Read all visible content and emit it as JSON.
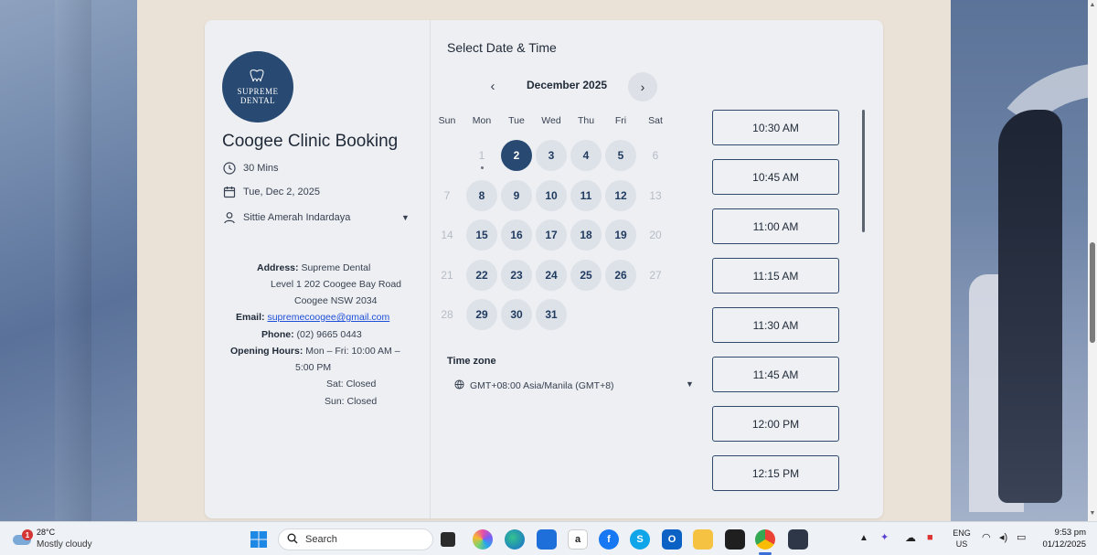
{
  "booking": {
    "logo_line1": "SUPREME",
    "logo_line2": "DENTAL",
    "title": "Coogee Clinic Booking",
    "duration": "30 Mins",
    "date": "Tue, Dec 2, 2025",
    "staff": "Sittie Amerah Indardaya"
  },
  "address": {
    "address_label": "Address:",
    "address_line1": "Supreme Dental",
    "address_line2": "Level 1  202 Coogee Bay Road",
    "address_line3": "Coogee NSW 2034",
    "email_label": "Email:",
    "email": "supremecoogee@gmail.com",
    "phone_label": "Phone:",
    "phone": "(02) 9665 0443",
    "hours_label": "Opening Hours:",
    "hours_line1": "Mon – Fri: 10:00 AM –",
    "hours_line2": "5:00 PM",
    "hours_sat": "Sat: Closed",
    "hours_sun": "Sun: Closed"
  },
  "calendar": {
    "section_title": "Select Date & Time",
    "month_label": "December 2025",
    "prev_icon": "‹",
    "next_icon": "›",
    "weekdays": [
      "Sun",
      "Mon",
      "Tue",
      "Wed",
      "Thu",
      "Fri",
      "Sat"
    ],
    "weeks": [
      [
        {
          "d": "",
          "s": "empty"
        },
        {
          "d": "1",
          "s": "off",
          "today": true
        },
        {
          "d": "2",
          "s": "sel"
        },
        {
          "d": "3",
          "s": "avail"
        },
        {
          "d": "4",
          "s": "avail"
        },
        {
          "d": "5",
          "s": "avail"
        },
        {
          "d": "6",
          "s": "off"
        }
      ],
      [
        {
          "d": "7",
          "s": "off"
        },
        {
          "d": "8",
          "s": "avail"
        },
        {
          "d": "9",
          "s": "avail"
        },
        {
          "d": "10",
          "s": "avail"
        },
        {
          "d": "11",
          "s": "avail"
        },
        {
          "d": "12",
          "s": "avail"
        },
        {
          "d": "13",
          "s": "off"
        }
      ],
      [
        {
          "d": "14",
          "s": "off"
        },
        {
          "d": "15",
          "s": "avail"
        },
        {
          "d": "16",
          "s": "avail"
        },
        {
          "d": "17",
          "s": "avail"
        },
        {
          "d": "18",
          "s": "avail"
        },
        {
          "d": "19",
          "s": "avail"
        },
        {
          "d": "20",
          "s": "off"
        }
      ],
      [
        {
          "d": "21",
          "s": "off"
        },
        {
          "d": "22",
          "s": "avail"
        },
        {
          "d": "23",
          "s": "avail"
        },
        {
          "d": "24",
          "s": "avail"
        },
        {
          "d": "25",
          "s": "avail"
        },
        {
          "d": "26",
          "s": "avail"
        },
        {
          "d": "27",
          "s": "off"
        }
      ],
      [
        {
          "d": "28",
          "s": "off"
        },
        {
          "d": "29",
          "s": "avail"
        },
        {
          "d": "30",
          "s": "avail"
        },
        {
          "d": "31",
          "s": "avail"
        },
        {
          "d": "",
          "s": "empty"
        },
        {
          "d": "",
          "s": "empty"
        },
        {
          "d": "",
          "s": "empty"
        }
      ]
    ],
    "timezone_label": "Time zone",
    "timezone_value": "GMT+08:00 Asia/Manila (GMT+8)"
  },
  "time_slots": [
    "10:30 AM",
    "10:45 AM",
    "11:00 AM",
    "11:15 AM",
    "11:30 AM",
    "11:45 AM",
    "12:00 PM",
    "12:15 PM"
  ],
  "taskbar": {
    "weather_badge": "1",
    "weather_temp": "28°C",
    "weather_desc": "Mostly cloudy",
    "search_placeholder": "Search",
    "lang_line1": "ENG",
    "lang_line2": "US",
    "time": "9:53 pm",
    "date": "01/12/2025"
  },
  "colors": {
    "brand_navy": "#284a72",
    "selected_day": "#284a72",
    "available_day_bg": "#dde1e8",
    "slot_border": "#2f4a6d"
  },
  "icons": {
    "duration": "clock-icon",
    "date": "calendar-icon",
    "staff": "person-icon",
    "timezone": "globe-icon"
  }
}
